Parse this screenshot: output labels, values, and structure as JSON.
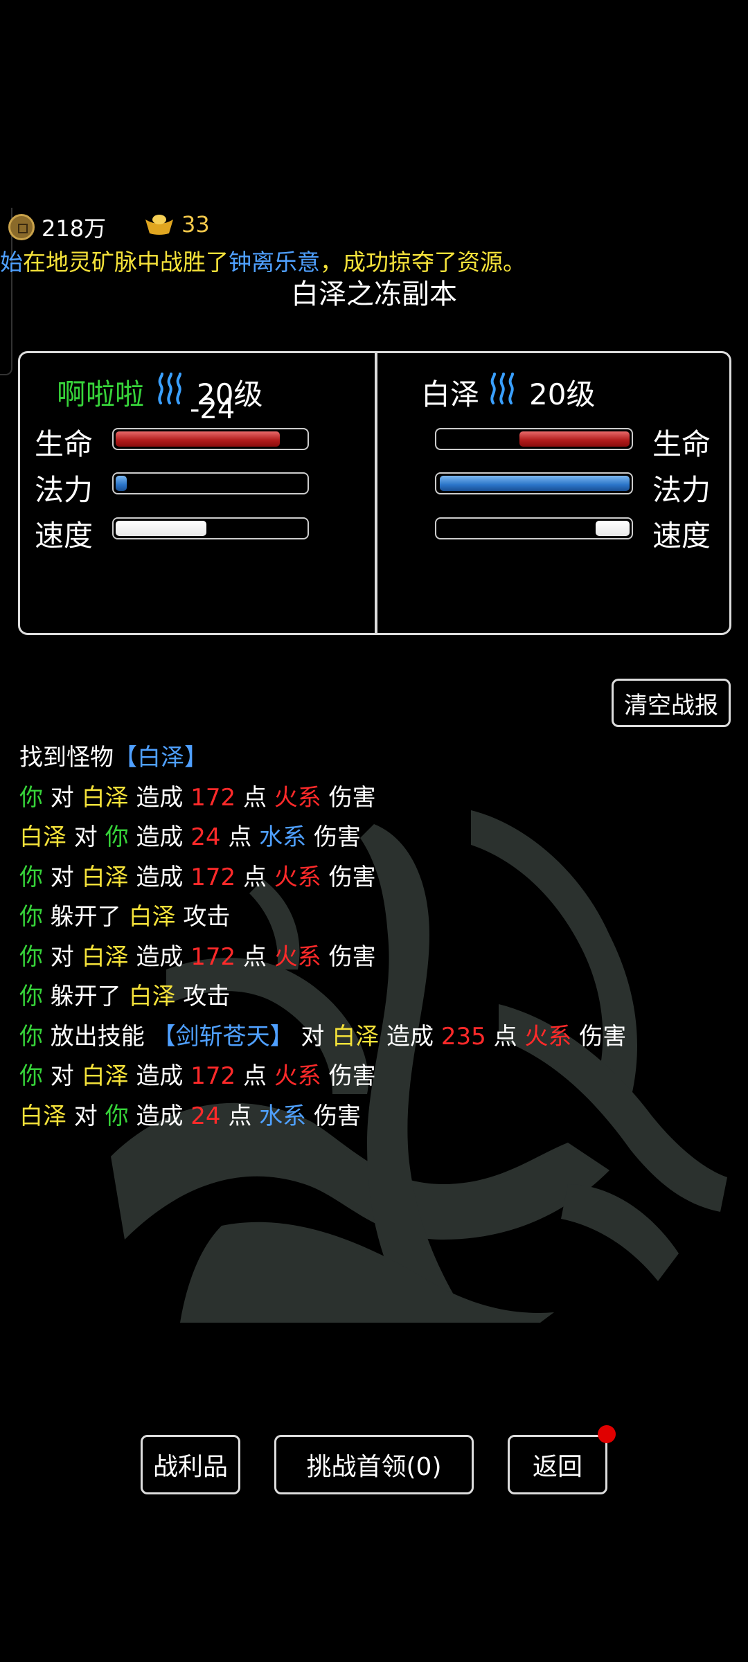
{
  "currency": {
    "coins": "218万",
    "gold": "33"
  },
  "broadcast": {
    "prefix": "始",
    "text1": "在地灵矿脉中战胜了",
    "name": "钟离乐意",
    "text2": "，成功掠夺了资源。"
  },
  "dungeon_title": "白泽之冻副本",
  "player": {
    "name": "啊啦啦",
    "level": "20级",
    "damage_float": "-24",
    "hp_fraction": 0.87,
    "mp_fraction": 0.06,
    "speed_fraction": 0.48
  },
  "enemy": {
    "name": "白泽",
    "level": "20级",
    "hp_fraction": 0.58,
    "mp_fraction": 1.0,
    "speed_fraction": 0.18
  },
  "stat_labels": {
    "hp": "生命",
    "mp": "法力",
    "speed": "速度"
  },
  "buttons": {
    "clear_log": "清空战报",
    "loot": "战利品",
    "challenge_boss": "挑战首领(0)",
    "back": "返回"
  },
  "log": {
    "found_prefix": "找到怪物",
    "found_monster": "【白泽】",
    "lines": [
      [
        {
          "t": "你",
          "c": "green"
        },
        {
          "t": " 对 ",
          "c": "white"
        },
        {
          "t": "白泽",
          "c": "yellow"
        },
        {
          "t": " 造成 ",
          "c": "white"
        },
        {
          "t": "172",
          "c": "red"
        },
        {
          "t": " 点 ",
          "c": "white"
        },
        {
          "t": "火系",
          "c": "red"
        },
        {
          "t": " 伤害",
          "c": "white"
        }
      ],
      [
        {
          "t": "白泽",
          "c": "yellow"
        },
        {
          "t": " 对 ",
          "c": "white"
        },
        {
          "t": "你",
          "c": "green"
        },
        {
          "t": " 造成 ",
          "c": "white"
        },
        {
          "t": "24",
          "c": "red"
        },
        {
          "t": " 点 ",
          "c": "white"
        },
        {
          "t": "水系",
          "c": "blue"
        },
        {
          "t": " 伤害",
          "c": "white"
        }
      ],
      [
        {
          "t": "你",
          "c": "green"
        },
        {
          "t": " 对 ",
          "c": "white"
        },
        {
          "t": "白泽",
          "c": "yellow"
        },
        {
          "t": " 造成 ",
          "c": "white"
        },
        {
          "t": "172",
          "c": "red"
        },
        {
          "t": " 点 ",
          "c": "white"
        },
        {
          "t": "火系",
          "c": "red"
        },
        {
          "t": " 伤害",
          "c": "white"
        }
      ],
      [
        {
          "t": "你",
          "c": "green"
        },
        {
          "t": " 躲开了 ",
          "c": "white"
        },
        {
          "t": "白泽",
          "c": "yellow"
        },
        {
          "t": " 攻击",
          "c": "white"
        }
      ],
      [
        {
          "t": "你",
          "c": "green"
        },
        {
          "t": " 对 ",
          "c": "white"
        },
        {
          "t": "白泽",
          "c": "yellow"
        },
        {
          "t": " 造成 ",
          "c": "white"
        },
        {
          "t": "172",
          "c": "red"
        },
        {
          "t": " 点 ",
          "c": "white"
        },
        {
          "t": "火系",
          "c": "red"
        },
        {
          "t": " 伤害",
          "c": "white"
        }
      ],
      [
        {
          "t": "你",
          "c": "green"
        },
        {
          "t": " 躲开了 ",
          "c": "white"
        },
        {
          "t": "白泽",
          "c": "yellow"
        },
        {
          "t": " 攻击",
          "c": "white"
        }
      ],
      [
        {
          "t": "你",
          "c": "green"
        },
        {
          "t": " 放出技能 ",
          "c": "white"
        },
        {
          "t": "【剑斩苍天】",
          "c": "blue"
        },
        {
          "t": " 对 ",
          "c": "white"
        },
        {
          "t": "白泽",
          "c": "yellow"
        },
        {
          "t": " 造成 ",
          "c": "white"
        },
        {
          "t": "235",
          "c": "red"
        },
        {
          "t": " 点 ",
          "c": "white"
        },
        {
          "t": "火系",
          "c": "red"
        },
        {
          "t": " 伤害",
          "c": "white"
        }
      ],
      [
        {
          "t": "你",
          "c": "green"
        },
        {
          "t": " 对 ",
          "c": "white"
        },
        {
          "t": "白泽",
          "c": "yellow"
        },
        {
          "t": " 造成 ",
          "c": "white"
        },
        {
          "t": "172",
          "c": "red"
        },
        {
          "t": " 点 ",
          "c": "white"
        },
        {
          "t": "火系",
          "c": "red"
        },
        {
          "t": " 伤害",
          "c": "white"
        }
      ],
      [
        {
          "t": "白泽",
          "c": "yellow"
        },
        {
          "t": " 对 ",
          "c": "white"
        },
        {
          "t": "你",
          "c": "green"
        },
        {
          "t": " 造成 ",
          "c": "white"
        },
        {
          "t": "24",
          "c": "red"
        },
        {
          "t": " 点 ",
          "c": "white"
        },
        {
          "t": "水系",
          "c": "blue"
        },
        {
          "t": " 伤害",
          "c": "white"
        }
      ]
    ]
  },
  "colors": {
    "player_name": "#37d43a",
    "accent_blue": "#4fa0ff",
    "broadcast": "#f5e23a",
    "damage": "#ff2a2a"
  },
  "icons": {
    "coin": "coin-icon",
    "gold": "gold-ingot-icon",
    "aura": "aura-icon"
  }
}
